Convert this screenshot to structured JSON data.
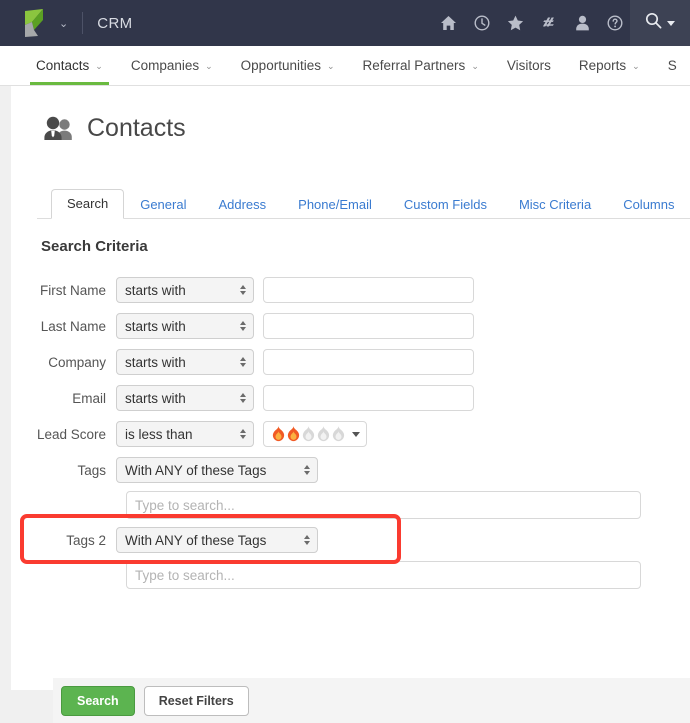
{
  "topbar": {
    "app_name": "CRM",
    "logo_icon": "keap-logo-icon",
    "logo_caret_glyph": "⌄",
    "icons": [
      {
        "name": "home-icon"
      },
      {
        "name": "clock-icon"
      },
      {
        "name": "star-icon"
      },
      {
        "name": "campaign-icon"
      },
      {
        "name": "person-icon"
      },
      {
        "name": "help-icon"
      }
    ],
    "search": {
      "name": "search-icon",
      "has_dropdown": true
    },
    "bg_color": "#31364a",
    "search_bg_color": "#3d4254"
  },
  "nav": {
    "items": [
      {
        "label": "Contacts",
        "has_caret": true,
        "active": true
      },
      {
        "label": "Companies",
        "has_caret": true,
        "active": false
      },
      {
        "label": "Opportunities",
        "has_caret": true,
        "active": false
      },
      {
        "label": "Referral Partners",
        "has_caret": true,
        "active": false
      },
      {
        "label": "Visitors",
        "has_caret": false,
        "active": false
      },
      {
        "label": "Reports",
        "has_caret": true,
        "active": false
      },
      {
        "label": "S",
        "has_caret": false,
        "active": false
      }
    ],
    "active_underline_color": "#6aba3f",
    "caret_glyph": "⌄"
  },
  "page": {
    "title": "Contacts",
    "title_icon": "users-icon"
  },
  "tabs": [
    {
      "label": "Search",
      "active": true
    },
    {
      "label": "General",
      "active": false
    },
    {
      "label": "Address",
      "active": false
    },
    {
      "label": "Phone/Email",
      "active": false
    },
    {
      "label": "Custom Fields",
      "active": false
    },
    {
      "label": "Misc Criteria",
      "active": false
    },
    {
      "label": "Columns",
      "active": false
    }
  ],
  "search_criteria": {
    "heading": "Search Criteria",
    "rows": [
      {
        "label": "First Name",
        "operator": "starts with",
        "value": "",
        "type": "text"
      },
      {
        "label": "Last Name",
        "operator": "starts with",
        "value": "",
        "type": "text"
      },
      {
        "label": "Company",
        "operator": "starts with",
        "value": "",
        "type": "text"
      },
      {
        "label": "Email",
        "operator": "starts with",
        "value": "",
        "type": "text"
      }
    ],
    "lead_score": {
      "label": "Lead Score",
      "operator": "is less than",
      "flames_total": 5,
      "flames_filled": 2,
      "flame_on_color": "#f15a24",
      "flame_off_color": "#d8d8d8",
      "highlighted": true,
      "highlight_color": "#fa3b30"
    },
    "tags": {
      "label": "Tags",
      "mode": "With ANY of these Tags",
      "search_value": "",
      "search_placeholder": "Type to search..."
    },
    "tags2": {
      "label": "Tags 2",
      "mode": "With ANY of these Tags",
      "search_value": "",
      "search_placeholder": "Type to search..."
    }
  },
  "footer": {
    "search_label": "Search",
    "reset_label": "Reset Filters",
    "primary_color": "#5cb450"
  }
}
